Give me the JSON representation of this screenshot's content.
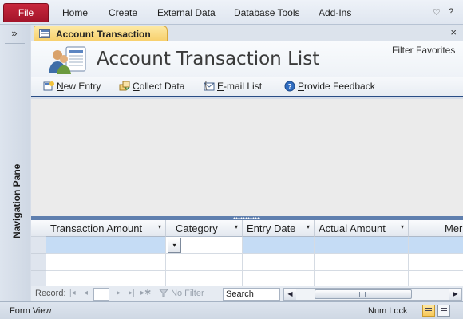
{
  "ribbon": {
    "file_label": "File",
    "tabs": [
      "Home",
      "Create",
      "External Data",
      "Database Tools",
      "Add-Ins"
    ],
    "minimize_glyph": "♡",
    "help_glyph": "?"
  },
  "nav_pane": {
    "toggle_glyph": "»",
    "label": "Navigation Pane"
  },
  "document_tab": {
    "label": "Account Transaction List",
    "close_glyph": "×"
  },
  "form_header": {
    "title": "Account Transaction List",
    "filter_link": "Filter Favorites"
  },
  "commands": [
    {
      "prefix": "",
      "hotkey": "N",
      "rest": "ew Entry",
      "icon": "new-entry-icon"
    },
    {
      "prefix": "",
      "hotkey": "C",
      "rest": "ollect Data",
      "icon": "collect-data-icon"
    },
    {
      "prefix": "",
      "hotkey": "E",
      "rest": "-mail List",
      "icon": "email-list-icon"
    },
    {
      "prefix": "",
      "hotkey": "P",
      "rest": "rovide Feedback",
      "icon": "help-icon"
    }
  ],
  "datasheet": {
    "columns": [
      "Transaction Amount",
      "Category",
      "Entry Date",
      "Actual Amount",
      "Mer"
    ],
    "dropdown_glyph": "▾"
  },
  "record_nav": {
    "label": "Record:",
    "first_glyph": "|◂",
    "prev_glyph": "◂",
    "next_glyph": "▸",
    "last_glyph": "▸|",
    "new_glyph": "▸✱",
    "filter_label": "No Filter",
    "search_value": "Search"
  },
  "status_bar": {
    "view": "Form View",
    "num_lock": "Num Lock"
  },
  "colors": {
    "file_tab": "#b31b32",
    "doc_tab": "#f7cf6a",
    "splitter": "#5f7fae",
    "selected_row": "#c5dcf5"
  }
}
